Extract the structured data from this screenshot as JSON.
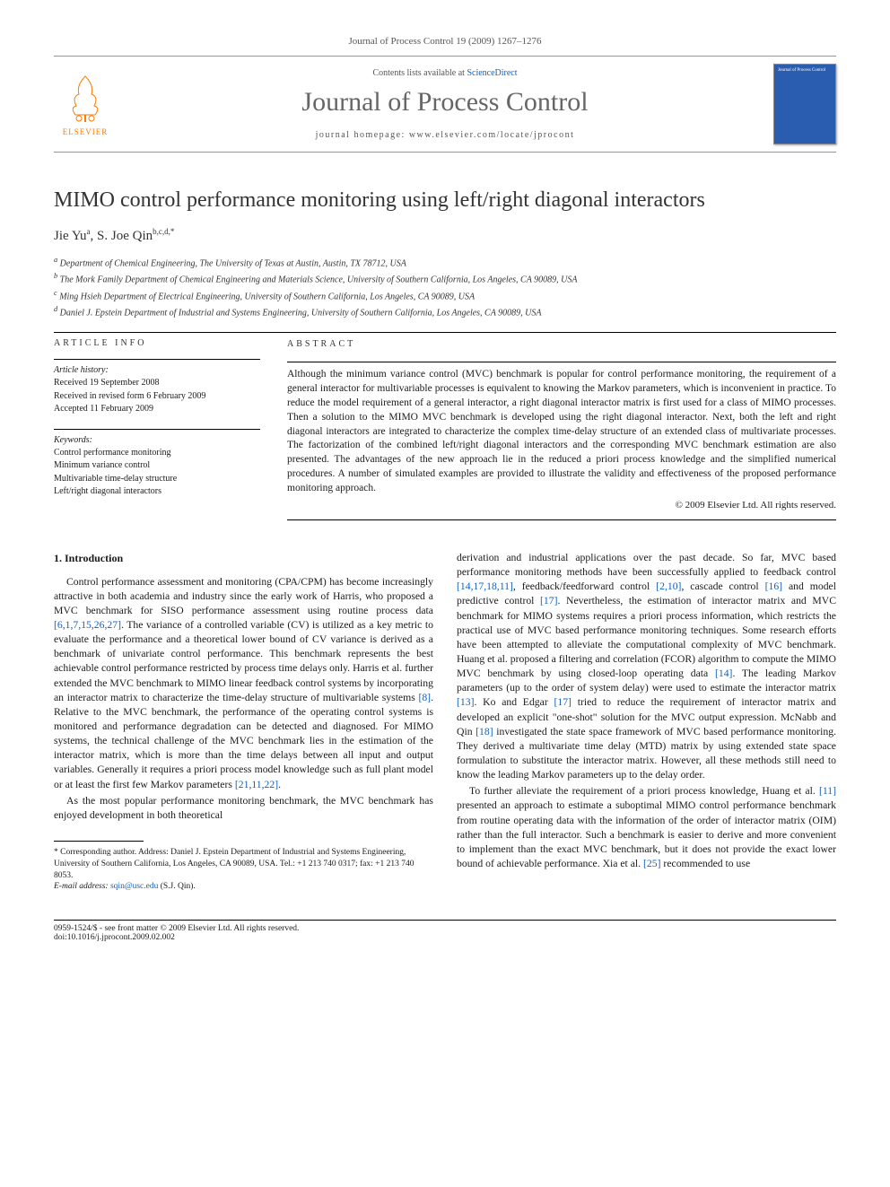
{
  "header": {
    "journal_ref": "Journal of Process Control 19 (2009) 1267–1276",
    "contents_prefix": "Contents lists available at ",
    "contents_link": "ScienceDirect",
    "journal_title": "Journal of Process Control",
    "homepage_prefix": "journal homepage: ",
    "homepage_url": "www.elsevier.com/locate/jprocont",
    "publisher": "ELSEVIER",
    "cover_label": "Journal of Process Control"
  },
  "paper": {
    "title": "MIMO control performance monitoring using left/right diagonal interactors",
    "authors_html": "Jie Yu ",
    "author1": "Jie Yu",
    "author1_sup": "a",
    "author_sep": ", ",
    "author2": "S. Joe Qin",
    "author2_sup": "b,c,d,*",
    "affiliations": {
      "a": "Department of Chemical Engineering, The University of Texas at Austin, Austin, TX 78712, USA",
      "b": "The Mork Family Department of Chemical Engineering and Materials Science, University of Southern California, Los Angeles, CA 90089, USA",
      "c": "Ming Hsieh Department of Electrical Engineering, University of Southern California, Los Angeles, CA 90089, USA",
      "d": "Daniel J. Epstein Department of Industrial and Systems Engineering, University of Southern California, Los Angeles, CA 90089, USA"
    }
  },
  "article_info": {
    "label": "ARTICLE INFO",
    "history_title": "Article history:",
    "received": "Received 19 September 2008",
    "revised": "Received in revised form 6 February 2009",
    "accepted": "Accepted 11 February 2009",
    "keywords_title": "Keywords:",
    "keywords": [
      "Control performance monitoring",
      "Minimum variance control",
      "Multivariable time-delay structure",
      "Left/right diagonal interactors"
    ]
  },
  "abstract": {
    "label": "ABSTRACT",
    "text": "Although the minimum variance control (MVC) benchmark is popular for control performance monitoring, the requirement of a general interactor for multivariable processes is equivalent to knowing the Markov parameters, which is inconvenient in practice. To reduce the model requirement of a general interactor, a right diagonal interactor matrix is first used for a class of MIMO processes. Then a solution to the MIMO MVC benchmark is developed using the right diagonal interactor. Next, both the left and right diagonal interactors are integrated to characterize the complex time-delay structure of an extended class of multivariate processes. The factorization of the combined left/right diagonal interactors and the corresponding MVC benchmark estimation are also presented. The advantages of the new approach lie in the reduced a priori process knowledge and the simplified numerical procedures. A number of simulated examples are provided to illustrate the validity and effectiveness of the proposed performance monitoring approach.",
    "copyright": "© 2009 Elsevier Ltd. All rights reserved."
  },
  "body": {
    "section1_title": "1. Introduction",
    "col1_p1a": "Control performance assessment and monitoring (CPA/CPM) has become increasingly attractive in both academia and industry since the early work of Harris, who proposed a MVC benchmark for SISO performance assessment using routine process data ",
    "col1_refs1": "[6,1,7,15,26,27]",
    "col1_p1b": ". The variance of a controlled variable (CV) is utilized as a key metric to evaluate the performance and a theoretical lower bound of CV variance is derived as a benchmark of univariate control performance. This benchmark represents the best achievable control performance restricted by process time delays only. Harris et al. further extended the MVC benchmark to MIMO linear feedback control systems by incorporating an interactor matrix to characterize the time-delay structure of multivariable systems ",
    "col1_refs2": "[8]",
    "col1_p1c": ". Relative to the MVC benchmark, the performance of the operating control systems is monitored and performance degradation can be detected and diagnosed. For MIMO systems, the technical challenge of the MVC benchmark lies in the estimation of the interactor matrix, which is more than the time delays between all input and output variables. Generally it requires a priori process model knowledge such as full plant model or at least the first few Markov parameters ",
    "col1_refs3": "[21,11,22]",
    "col1_p1d": ".",
    "col1_p2": "As the most popular performance monitoring benchmark, the MVC benchmark has enjoyed development in both theoretical",
    "col2_p1a": "derivation and industrial applications over the past decade. So far, MVC based performance monitoring methods have been successfully applied to feedback control ",
    "col2_refs1": "[14,17,18,11]",
    "col2_p1b": ", feedback/feedforward control ",
    "col2_refs2": "[2,10]",
    "col2_p1c": ", cascade control ",
    "col2_refs3": "[16]",
    "col2_p1d": " and model predictive control ",
    "col2_refs4": "[17]",
    "col2_p1e": ". Nevertheless, the estimation of interactor matrix and MVC benchmark for MIMO systems requires a priori process information, which restricts the practical use of MVC based performance monitoring techniques. Some research efforts have been attempted to alleviate the computational complexity of MVC benchmark. Huang et al. proposed a filtering and correlation (FCOR) algorithm to compute the MIMO MVC benchmark by using closed-loop operating data ",
    "col2_refs5": "[14]",
    "col2_p1f": ". The leading Markov parameters (up to the order of system delay) were used to estimate the interactor matrix ",
    "col2_refs6": "[13]",
    "col2_p1g": ". Ko and Edgar ",
    "col2_refs7": "[17]",
    "col2_p1h": " tried to reduce the requirement of interactor matrix and developed an explicit \"one-shot\" solution for the MVC output expression. McNabb and Qin ",
    "col2_refs8": "[18]",
    "col2_p1i": " investigated the state space framework of MVC based performance monitoring. They derived a multivariate time delay (MTD) matrix by using extended state space formulation to substitute the interactor matrix. However, all these methods still need to know the leading Markov parameters up to the delay order.",
    "col2_p2a": "To further alleviate the requirement of a priori process knowledge, Huang et al. ",
    "col2_refs9": "[11]",
    "col2_p2b": " presented an approach to estimate a suboptimal MIMO control performance benchmark from routine operating data with the information of the order of interactor matrix (OIM) rather than the full interactor. Such a benchmark is easier to derive and more convenient to implement than the exact MVC benchmark, but it does not provide the exact lower bound of achievable performance. Xia et al. ",
    "col2_refs10": "[25]",
    "col2_p2c": " recommended to use"
  },
  "footnotes": {
    "corr": "* Corresponding author. Address: Daniel J. Epstein Department of Industrial and Systems Engineering, University of Southern California, Los Angeles, CA 90089, USA. Tel.: +1 213 740 0317; fax: +1 213 740 8053.",
    "email_label": "E-mail address:",
    "email": "sqin@usc.edu",
    "email_suffix": "(S.J. Qin)."
  },
  "footer": {
    "line1": "0959-1524/$ - see front matter © 2009 Elsevier Ltd. All rights reserved.",
    "line2": "doi:10.1016/j.jprocont.2009.02.002"
  }
}
